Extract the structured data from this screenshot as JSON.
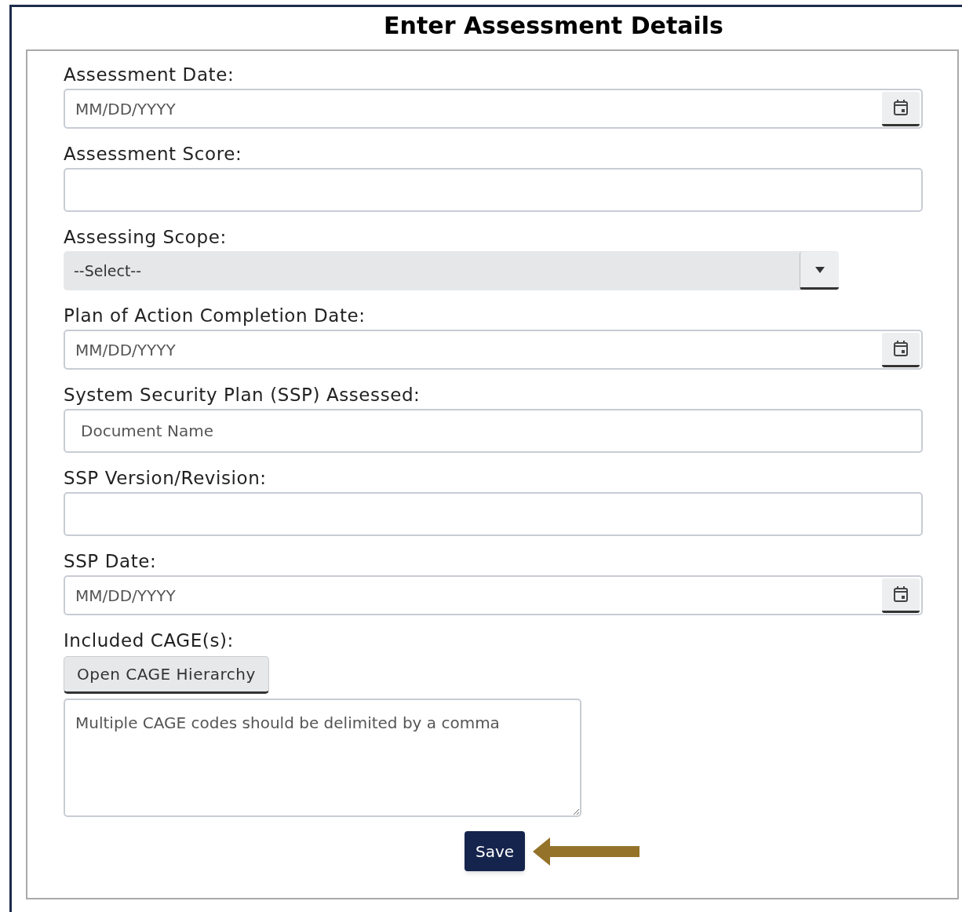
{
  "title": "Enter Assessment Details",
  "fields": [
    {
      "kind": "date",
      "label": "Assessment Date:",
      "placeholder": "MM/DD/YYYY"
    },
    {
      "kind": "text",
      "label": "Assessment Score:"
    },
    {
      "kind": "select",
      "label": "Assessing Scope:",
      "value": "--Select--"
    },
    {
      "kind": "date",
      "label": "Plan of Action Completion Date:",
      "placeholder": "MM/DD/YYYY"
    },
    {
      "kind": "text",
      "label": "System Security Plan (SSP) Assessed:",
      "placeholder": "Document Name"
    },
    {
      "kind": "text",
      "label": "SSP Version/Revision:"
    },
    {
      "kind": "date",
      "label": "SSP Date:",
      "placeholder": "MM/DD/YYYY"
    },
    {
      "kind": "cage",
      "label": "Included CAGE(s):",
      "button": "Open CAGE Hierarchy",
      "placeholder": "Multiple CAGE codes should be delimited by a comma"
    }
  ],
  "save_button": "Save"
}
